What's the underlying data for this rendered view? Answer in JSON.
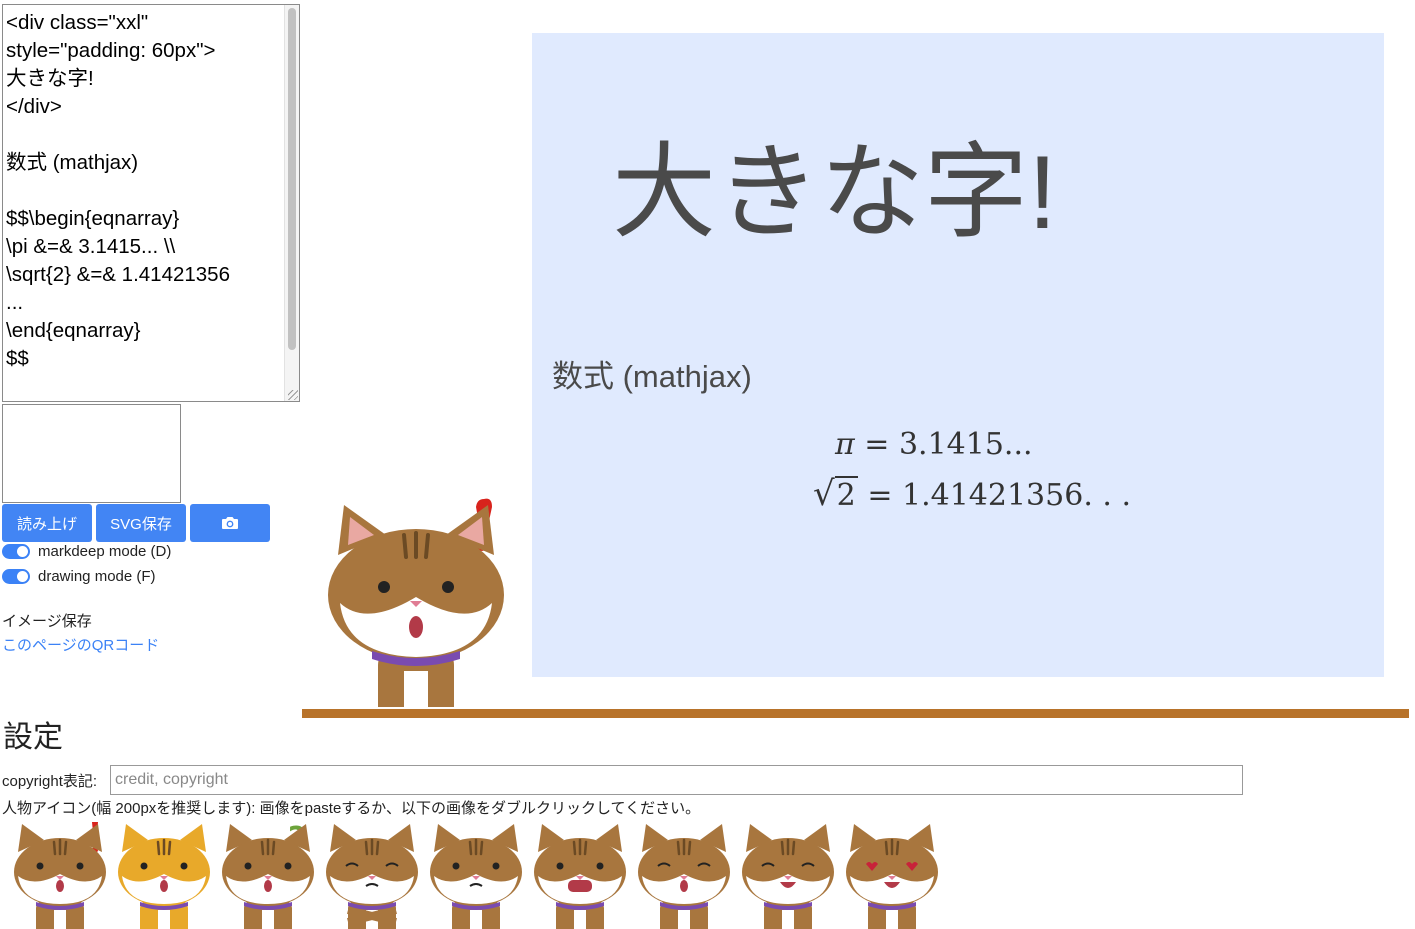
{
  "editor": {
    "content": "<div class=\"xxl\"\nstyle=\"padding: 60px\">\n大きな字!\n</div>\n\n数式 (mathjax)\n\n$$\\begin{eqnarray}\n\\pi &=& 3.1415... \\\\\n\\sqrt{2} &=& 1.41421356\n...\n\\end{eqnarray}\n$$"
  },
  "speech_box": {
    "value": ""
  },
  "buttons": {
    "read_label": "読み上げ",
    "svg_label": "SVG保存",
    "camera_icon": "camera-icon"
  },
  "toggles": {
    "markdeep_label": "markdeep mode (D)",
    "markdeep_on": true,
    "drawing_label": "drawing mode (F)",
    "drawing_on": true
  },
  "image_save_label": "イメージ保存",
  "qr_link_label": "このページのQRコード",
  "slide": {
    "big_text": "大きな字!",
    "heading": "数式 (mathjax)",
    "math": {
      "line1_lhs": "π",
      "line1_eq": "=",
      "line1_rhs": "3.1415...",
      "line2_radicand": "2",
      "line2_eq": "=",
      "line2_rhs": "1.41421356. . ."
    },
    "background": "#e0eafe"
  },
  "character": {
    "expression": "surprised-exclamation"
  },
  "settings": {
    "title": "設定",
    "copyright_label": "copyright表記:",
    "copyright_placeholder": "credit, copyright",
    "copyright_value": "",
    "icon_instruction": "人物アイコン(幅 200pxを推奨します): 画像をpasteするか、以下の画像をダブルクリックしてください。",
    "icons": [
      "surprised",
      "yellow-cat-worried",
      "question",
      "crossed-arms",
      "sweat",
      "shocked",
      "smug",
      "happy",
      "heart-eyes"
    ]
  },
  "colors": {
    "accent": "#4285f4",
    "link": "#3b82f6",
    "floor": "#b8732a",
    "cat_brown": "#a8763e",
    "collar": "#7a4bb0"
  }
}
